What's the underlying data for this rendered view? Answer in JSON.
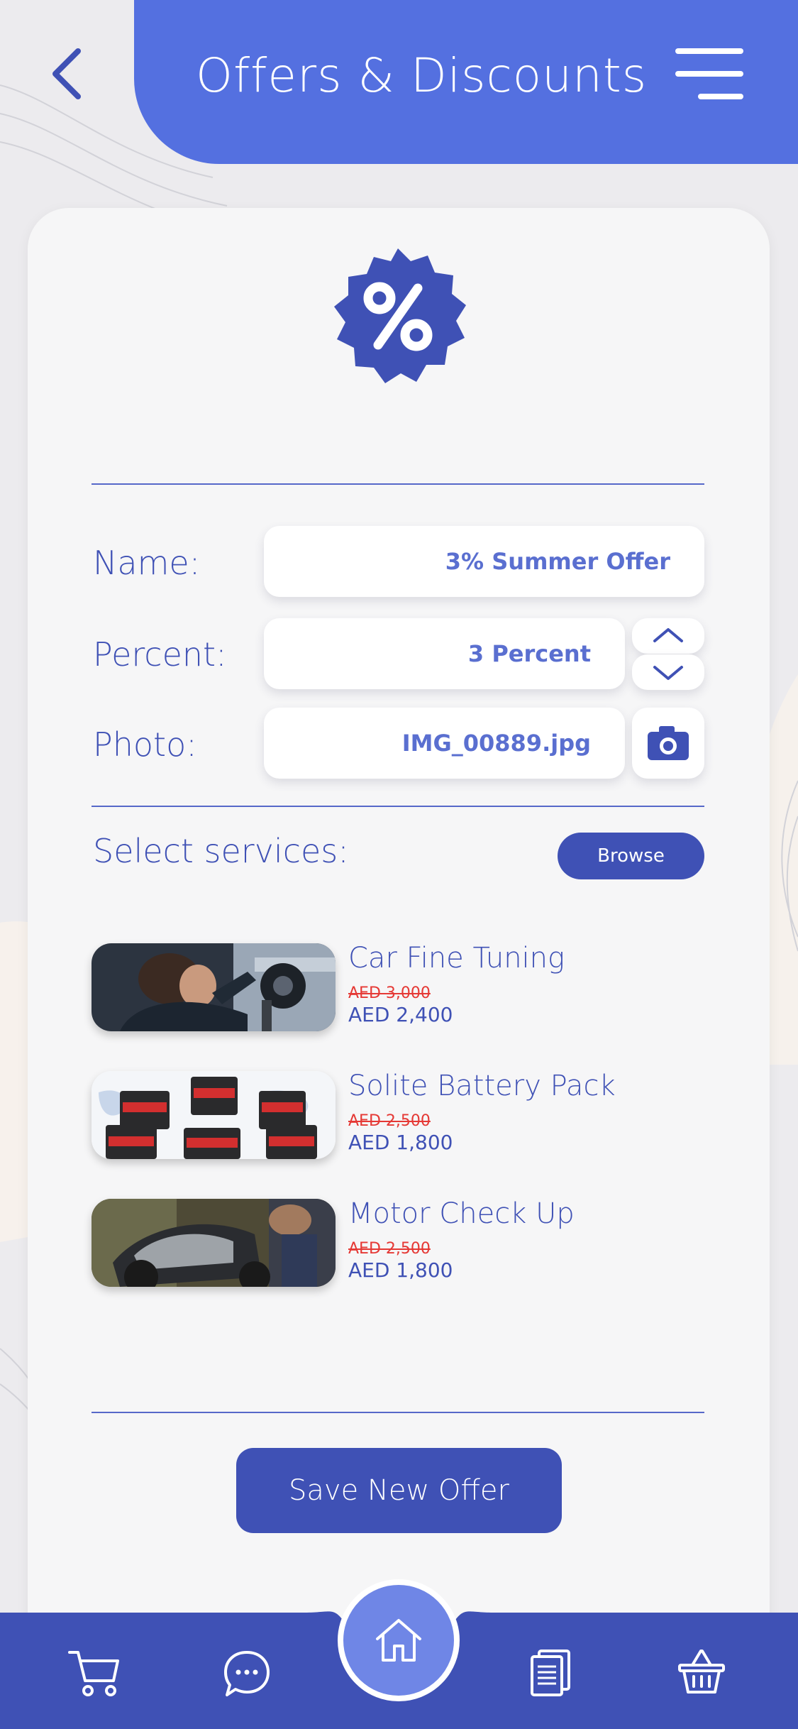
{
  "header": {
    "title": "Offers & Discounts"
  },
  "form": {
    "name_label": "Name:",
    "name_value": "3% Summer Offer",
    "percent_label": "Percent:",
    "percent_value": "3 Percent",
    "photo_label": "Photo:",
    "photo_value": "IMG_00889.jpg"
  },
  "services": {
    "label": "Select services:",
    "browse_label": "Browse",
    "items": [
      {
        "name": "Car Fine Tuning",
        "old_price": "AED 3,000",
        "new_price": "AED 2,400"
      },
      {
        "name": "Solite Battery Pack",
        "old_price": "AED 2,500",
        "new_price": "AED 1,800"
      },
      {
        "name": "Motor Check Up",
        "old_price": "AED 2,500",
        "new_price": "AED 1,800"
      }
    ]
  },
  "actions": {
    "save_label": "Save New Offer"
  },
  "nav": {
    "icons": [
      "cart-icon",
      "chat-icon",
      "home-icon",
      "documents-icon",
      "basket-icon"
    ]
  },
  "colors": {
    "primary": "#3f51b5",
    "header": "#5470e0",
    "accent_light": "#6f86e6",
    "strike": "#e53935",
    "card": "#f6f6f7"
  }
}
